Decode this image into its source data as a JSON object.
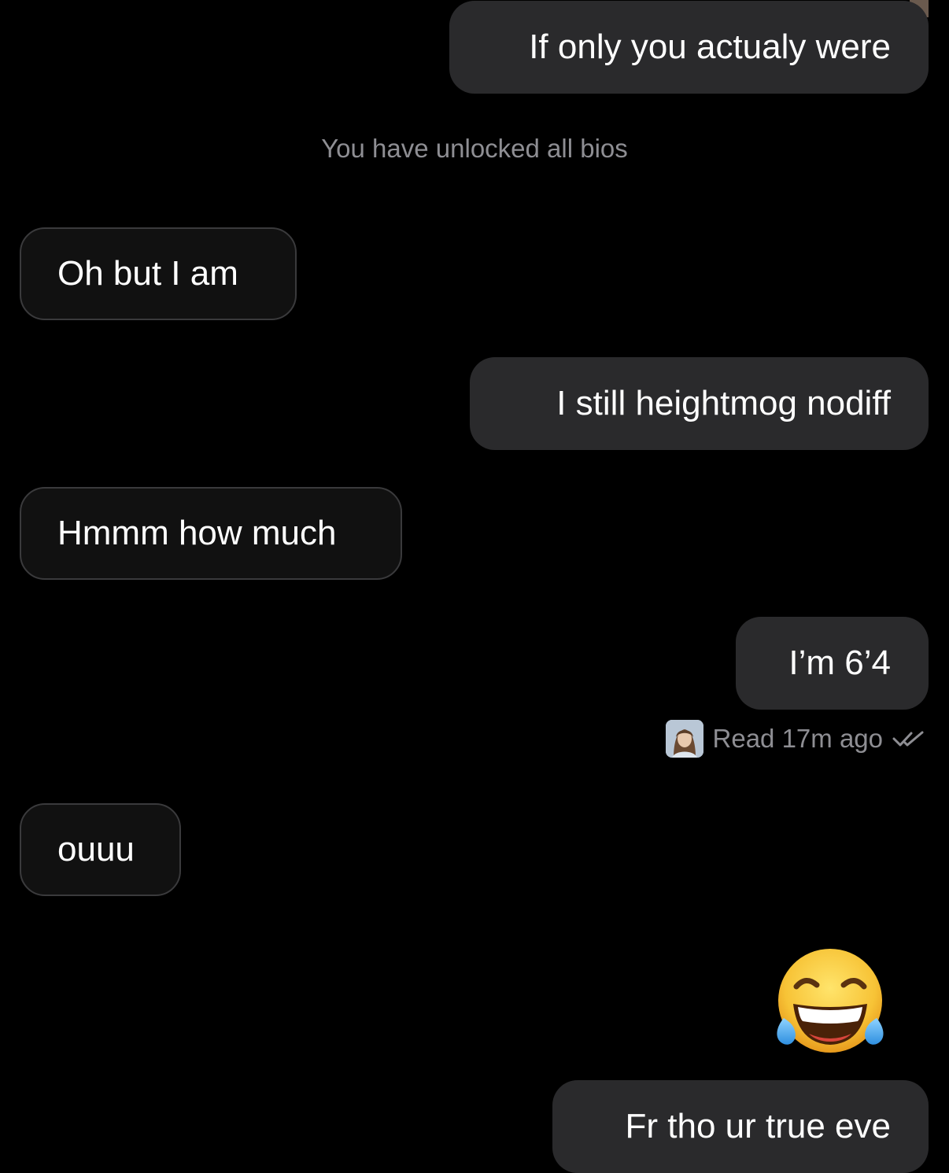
{
  "messages": [
    {
      "side": "sent",
      "text": "If only you actualy were"
    },
    {
      "side": "system",
      "text": "You have unlocked all bios"
    },
    {
      "side": "received",
      "text": "Oh but I am"
    },
    {
      "side": "sent",
      "text": "I still heightmog nodiff"
    },
    {
      "side": "received",
      "text": "Hmmm how much"
    },
    {
      "side": "sent",
      "text": "I’m 6’4"
    },
    {
      "side": "received",
      "text": "ouuu"
    },
    {
      "side": "sent",
      "emoji": "face-with-tears-of-joy"
    },
    {
      "side": "sent",
      "text": "Fr tho ur true eve"
    }
  ],
  "read_receipt": {
    "text": "Read 17m ago",
    "icon": "double-check-icon"
  },
  "colors": {
    "background": "#000000",
    "sent_bubble": "#2a2a2c",
    "received_bubble": "#111111",
    "received_border": "#3a3a3c",
    "muted_text": "#8e8e93"
  }
}
